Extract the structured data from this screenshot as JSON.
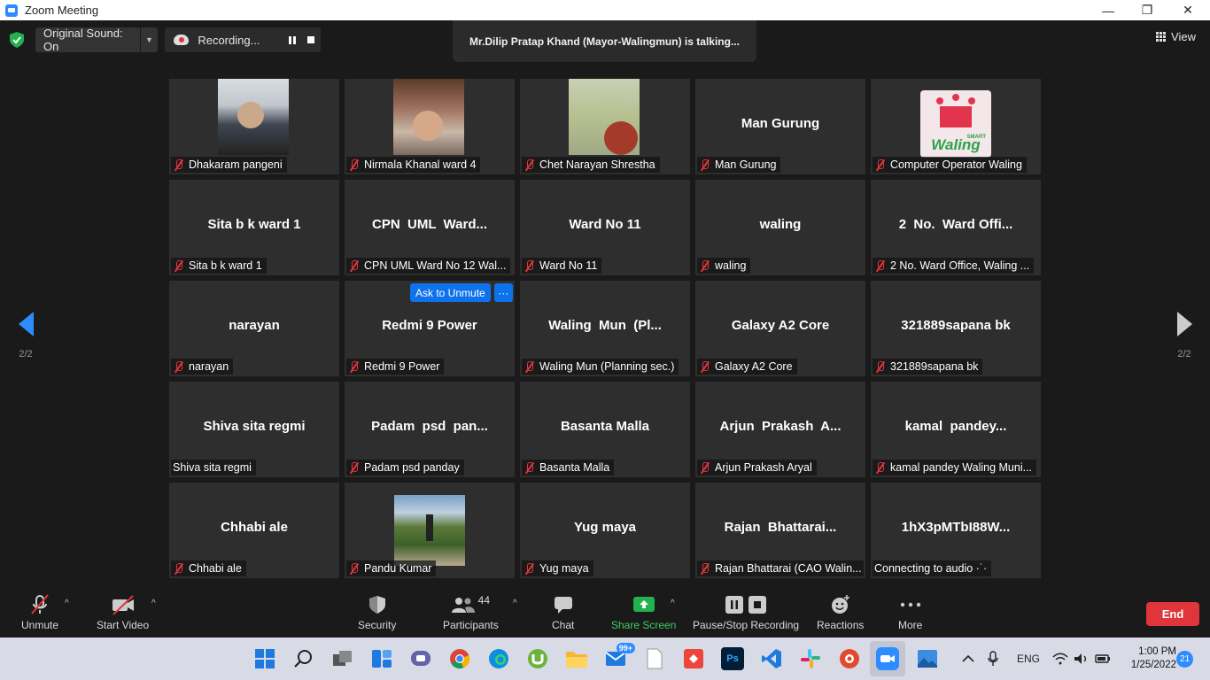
{
  "window": {
    "title": "Zoom Meeting",
    "minimize": "—",
    "maximize": "❐",
    "close": "✕"
  },
  "topbar": {
    "original_sound": "Original Sound: On",
    "recording_label": "Recording...",
    "talking": "Mr.Dilip Pratap Khand (Mayor-Walingmun) is talking...",
    "view_label": "View"
  },
  "paging": {
    "left": "2/2",
    "right": "2/2"
  },
  "ask_unmute": {
    "label": "Ask to Unmute",
    "more": "···"
  },
  "tiles": [
    {
      "big": "",
      "caption": "Dhakaram pangeni",
      "muted": true,
      "media": "cam1"
    },
    {
      "big": "",
      "caption": "Nirmala Khanal ward 4",
      "muted": true,
      "media": "cam2"
    },
    {
      "big": "",
      "caption": "Chet Narayan Shrestha",
      "muted": true,
      "media": "cam3"
    },
    {
      "big": "Man Gurung",
      "caption": "Man Gurung",
      "muted": true,
      "media": ""
    },
    {
      "big": "",
      "caption": "Computer Operator Waling",
      "muted": true,
      "media": "logo",
      "logo_text": "Waling",
      "logo_small": "SMART"
    },
    {
      "big": "Sita b k ward 1",
      "caption": "Sita b k ward 1",
      "muted": true,
      "media": ""
    },
    {
      "big": "CPN  UML  Ward...",
      "caption": "CPN UML Ward No 12 Wal...",
      "muted": true,
      "media": ""
    },
    {
      "big": "Ward No 11",
      "caption": "Ward No 11",
      "muted": true,
      "media": ""
    },
    {
      "big": "waling",
      "caption": "waling",
      "muted": true,
      "media": ""
    },
    {
      "big": "2  No.  Ward Offi...",
      "caption": "2 No. Ward Office, Waling ...",
      "muted": true,
      "media": ""
    },
    {
      "big": "narayan",
      "caption": "narayan",
      "muted": true,
      "media": ""
    },
    {
      "big": "Redmi 9 Power",
      "caption": "Redmi 9 Power",
      "muted": true,
      "media": ""
    },
    {
      "big": "Waling  Mun  (Pl...",
      "caption": "Waling Mun (Planning sec.)",
      "muted": true,
      "media": ""
    },
    {
      "big": "Galaxy A2 Core",
      "caption": "Galaxy A2 Core",
      "muted": true,
      "media": ""
    },
    {
      "big": "321889sapana bk",
      "caption": "321889sapana bk",
      "muted": true,
      "media": ""
    },
    {
      "big": "Shiva sita regmi",
      "caption": "Shiva sita regmi",
      "muted": false,
      "media": ""
    },
    {
      "big": "Padam  psd  pan...",
      "caption": "Padam psd panday",
      "muted": true,
      "media": ""
    },
    {
      "big": "Basanta Malla",
      "caption": "Basanta Malla",
      "muted": true,
      "media": ""
    },
    {
      "big": "Arjun  Prakash  A...",
      "caption": "Arjun Prakash Aryal",
      "muted": true,
      "media": ""
    },
    {
      "big": "kamal  pandey...",
      "caption": "kamal pandey Waling Muni...",
      "muted": true,
      "media": ""
    },
    {
      "big": "Chhabi ale",
      "caption": "Chhabi ale",
      "muted": true,
      "media": ""
    },
    {
      "big": "",
      "caption": "Pandu Kumar",
      "muted": true,
      "media": "cam4"
    },
    {
      "big": "Yug maya",
      "caption": "Yug maya",
      "muted": true,
      "media": ""
    },
    {
      "big": "Rajan  Bhattarai...",
      "caption": "Rajan Bhattarai (CAO Walin...",
      "muted": true,
      "media": ""
    },
    {
      "big": "1hX3pMTbI88W...",
      "caption": "Connecting to audio ·˙·",
      "muted": false,
      "media": ""
    }
  ],
  "toolbar": {
    "unmute": "Unmute",
    "start_video": "Start Video",
    "security": "Security",
    "participants": "Participants",
    "participants_count": "44",
    "chat": "Chat",
    "share_screen": "Share Screen",
    "pause_stop_recording": "Pause/Stop Recording",
    "reactions": "Reactions",
    "more": "More",
    "end": "End",
    "caret": "^"
  },
  "taskbar": {
    "mail_badge": "99+",
    "language": "ENG",
    "time": "1:00 PM",
    "date": "1/25/2022",
    "notifications": "21"
  },
  "colors": {
    "accent": "#2d8cff",
    "end": "#e0353a",
    "share": "#22b14c",
    "muted": "#e0353a"
  }
}
